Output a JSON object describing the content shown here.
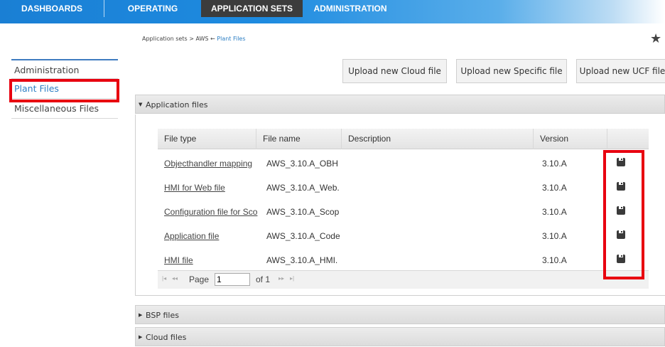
{
  "topnav": {
    "tabs": [
      {
        "label": "DASHBOARDS"
      },
      {
        "label": "OPERATING"
      },
      {
        "label": "APPLICATION SETS"
      },
      {
        "label": "ADMINISTRATION"
      }
    ]
  },
  "breadcrumb": {
    "root": "Application sets",
    "sep1": ">",
    "middle": "AWS",
    "arrow": "←",
    "current": "Plant Files"
  },
  "favorite_icon": "★",
  "sidebar": {
    "items": [
      {
        "label": "Administration"
      },
      {
        "label": "Plant Files"
      },
      {
        "label": "Miscellaneous Files"
      }
    ]
  },
  "upload_buttons": [
    {
      "label": "Upload new Cloud file"
    },
    {
      "label": "Upload new Specific file"
    },
    {
      "label": "Upload new UCF file"
    }
  ],
  "panels": {
    "application_files": {
      "label": "Application files",
      "expanded": true
    },
    "bsp_files": {
      "label": "BSP files",
      "expanded": false
    },
    "cloud_files": {
      "label": "Cloud files",
      "expanded": false
    }
  },
  "grid": {
    "headers": [
      "File type",
      "File name",
      "Description",
      "Version",
      ""
    ],
    "rows": [
      {
        "file_type": "Objecthandler mapping",
        "file_name": "AWS_3.10.A_OBH",
        "description": "",
        "version": "3.10.A",
        "icon": "save-icon"
      },
      {
        "file_type": "HMI for Web file",
        "file_name": "AWS_3.10.A_Web.",
        "description": "",
        "version": "3.10.A",
        "icon": "save-icon"
      },
      {
        "file_type": "Configuration file for Sco",
        "file_name": "AWS_3.10.A_Scop",
        "description": "",
        "version": "3.10.A",
        "icon": "save-icon"
      },
      {
        "file_type": "Application file",
        "file_name": "AWS_3.10.A_Code",
        "description": "",
        "version": "3.10.A",
        "icon": "save-icon"
      },
      {
        "file_type": "HMI file",
        "file_name": "AWS_3.10.A_HMI.",
        "description": "",
        "version": "3.10.A",
        "icon": "save-icon"
      }
    ]
  },
  "pager": {
    "page_label": "Page",
    "page_value": "1",
    "of_label": "of 1",
    "first": "|◂",
    "prev": "◂◂",
    "next": "▸▸",
    "last": "▸|"
  },
  "colors": {
    "nav_blue": "#1e8be0",
    "nav_dark": "#3c3c3c",
    "link_blue": "#2d7fc4",
    "highlight_red": "#e8000f"
  }
}
